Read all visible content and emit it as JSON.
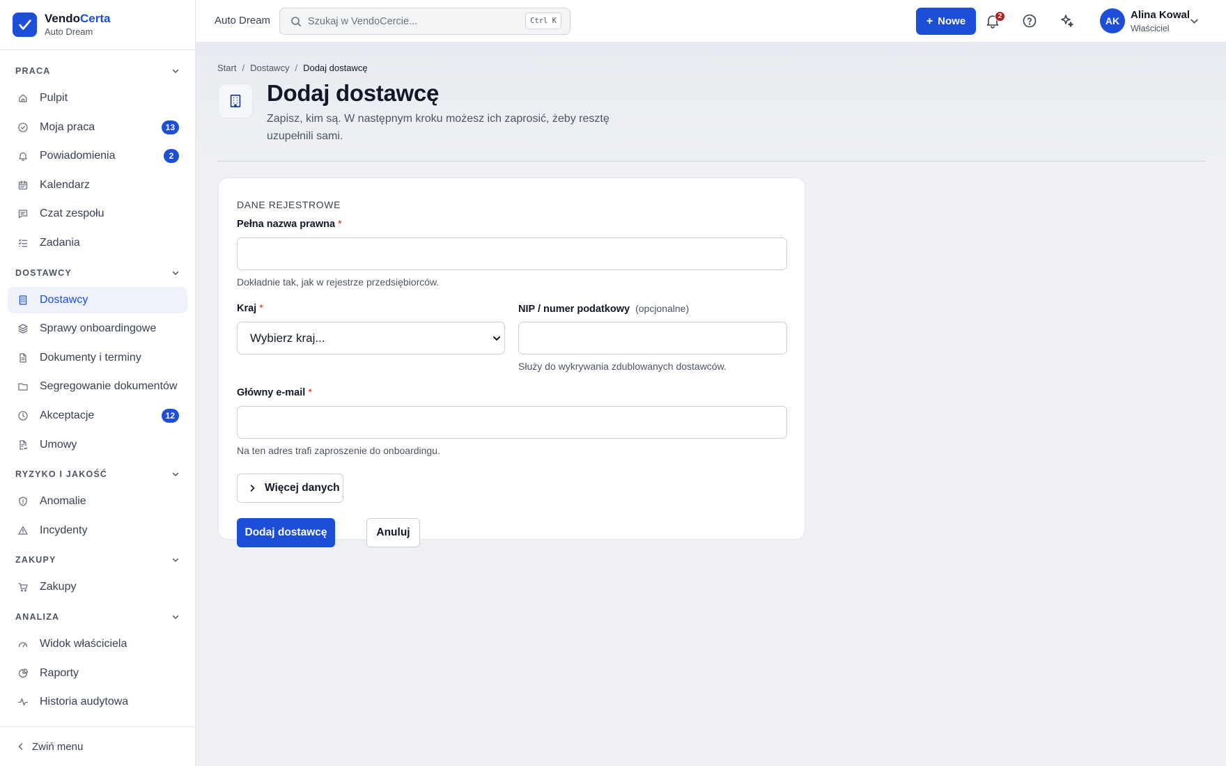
{
  "brand": {
    "name_main": "Vendo",
    "name_accent": "Certa",
    "workspace": "Auto Dream"
  },
  "topbar": {
    "workspace": "Auto Dream",
    "search_placeholder": "Szukaj w VendoCercie...",
    "search_shortcut": "Ctrl K",
    "new_label": "Nowe",
    "notifications_count": "2",
    "user": {
      "initials": "AK",
      "name": "Alina Kowal",
      "role": "Właściciel"
    }
  },
  "sidebar": {
    "sections": [
      {
        "title": "PRACA",
        "items": [
          {
            "label": "Pulpit",
            "icon": "home-icon"
          },
          {
            "label": "Moja praca",
            "icon": "check-circle-icon",
            "badge": "13"
          },
          {
            "label": "Powiadomienia",
            "icon": "bell-icon",
            "badge": "2"
          },
          {
            "label": "Kalendarz",
            "icon": "calendar-icon"
          },
          {
            "label": "Czat zespołu",
            "icon": "chat-icon"
          },
          {
            "label": "Zadania",
            "icon": "list-check-icon"
          }
        ]
      },
      {
        "title": "DOSTAWCY",
        "items": [
          {
            "label": "Dostawcy",
            "icon": "building-icon",
            "active": true
          },
          {
            "label": "Sprawy onboardingowe",
            "icon": "layers-icon"
          },
          {
            "label": "Dokumenty i terminy",
            "icon": "document-icon"
          },
          {
            "label": "Segregowanie dokumentów",
            "icon": "folder-icon"
          },
          {
            "label": "Akceptacje",
            "icon": "clock-icon",
            "badge": "12"
          },
          {
            "label": "Umowy",
            "icon": "contract-icon"
          }
        ]
      },
      {
        "title": "RYZYKO I JAKOŚĆ",
        "items": [
          {
            "label": "Anomalie",
            "icon": "shield-icon"
          },
          {
            "label": "Incydenty",
            "icon": "warning-icon"
          }
        ]
      },
      {
        "title": "ZAKUPY",
        "items": [
          {
            "label": "Zakupy",
            "icon": "cart-icon"
          }
        ]
      },
      {
        "title": "ANALIZA",
        "items": [
          {
            "label": "Widok właściciela",
            "icon": "gauge-icon"
          },
          {
            "label": "Raporty",
            "icon": "pie-chart-icon"
          },
          {
            "label": "Historia audytowa",
            "icon": "activity-icon"
          }
        ]
      }
    ],
    "collapse_label": "Zwiń menu"
  },
  "page": {
    "breadcrumb": [
      "Start",
      "Dostawcy",
      "Dodaj dostawcę"
    ],
    "title": "Dodaj dostawcę",
    "subtitle": "Zapisz, kim są. W następnym kroku możesz ich zaprosić, żeby resztę uzupełnili sami."
  },
  "form": {
    "section_title": "DANE REJESTROWE",
    "legal_name": {
      "label": "Pełna nazwa prawna",
      "value": "",
      "help": "Dokładnie tak, jak w rejestrze przedsiębiorców."
    },
    "country": {
      "label": "Kraj",
      "selected": "Wybierz kraj..."
    },
    "tax_id": {
      "label": "NIP / numer podatkowy",
      "optional": "(opcjonalne)",
      "value": "",
      "help": "Służy do wykrywania zdublowanych dostawców."
    },
    "email": {
      "label": "Główny e-mail",
      "value": "",
      "help": "Na ten adres trafi zaproszenie do onboardingu."
    },
    "required_mark": "*",
    "more_label": "Więcej danych",
    "submit_label": "Dodaj dostawcę",
    "cancel_label": "Anuluj"
  }
}
